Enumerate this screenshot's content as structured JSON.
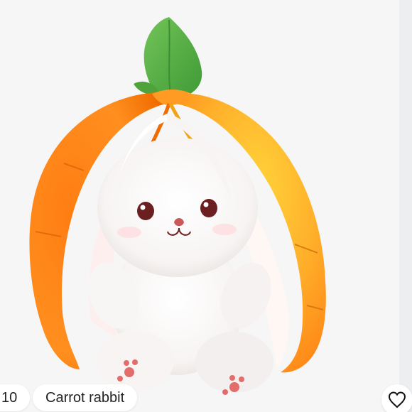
{
  "product": {
    "title": "Carrot rabbit",
    "price_fragment": "10"
  },
  "icons": {
    "favorite": "heart-outline-icon"
  },
  "colors": {
    "carrot": "#ff8a1f",
    "leaf": "#5fae45",
    "background": "#f6f6f6"
  }
}
